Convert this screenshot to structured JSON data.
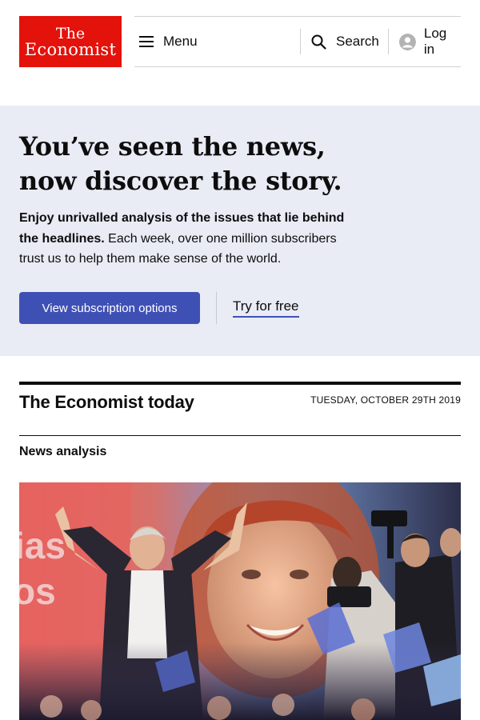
{
  "header": {
    "logo": {
      "line1": "The",
      "line2": "Economist"
    },
    "nav": {
      "menu_label": "Menu",
      "search_label": "Search",
      "login_label": "Log in"
    }
  },
  "promo": {
    "title_line1": "You’ve seen the news,",
    "title_line2": "now discover the story.",
    "text_bold": "Enjoy unrivalled analysis of the issues that lie behind the headlines.",
    "text_rest": " Each week, over one million subscribers trust us to help them make sense of the world.",
    "primary_button": "View subscription options",
    "secondary_link": "Try for free"
  },
  "today": {
    "title": "The Economist today",
    "date": "TUESDAY, OCTOBER 29TH 2019",
    "section": "News analysis"
  },
  "hero_image": {
    "background_text_1": "ias",
    "background_text_2": "os"
  },
  "colors": {
    "brand_red": "#e3120b",
    "accent_blue": "#3f50b5",
    "promo_bg": "#e9ebf5"
  },
  "icons": [
    "hamburger-icon",
    "search-icon",
    "user-avatar-icon"
  ]
}
